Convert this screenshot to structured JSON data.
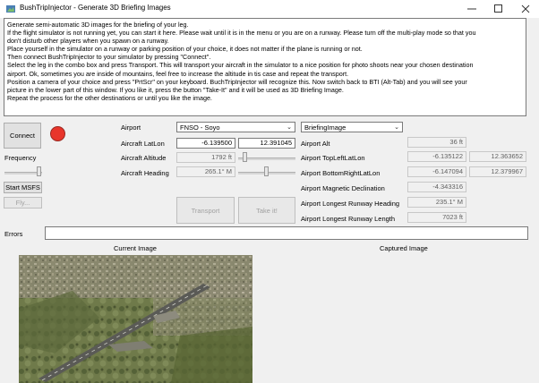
{
  "window": {
    "title": "BushTripInjector - Generate 3D Briefing Images",
    "minimize_icon": "minimize-icon",
    "maximize_icon": "maximize-icon",
    "close_icon": "close-icon"
  },
  "instructions": [
    "Generate semi-automatic 3D images for the briefing of your leg.",
    "If the flight simulator is not running yet, you can start it here. Please wait until it is in the menu or you are on a runway. Please turn off the multi-play mode so that you",
    "don't disturb other players when you spawn on a runway.",
    "Place yourself in the simulator on a runway or parking position of your choice, it does not matter if the plane is running or not.",
    "Then connect BushTripInjector to your simulator by pressing \"Connect\".",
    "Select the leg in the combo box and press Transport. This will transport your aircraft in the simulator to a nice position for photo shoots near your chosen destination",
    "airport. Ok, sometimes you are inside of mountains, feel free to increase the altitude in tis case and repeat the transport.",
    " Position a camera of your choice and press \"PrtScr\" on your keyboard. BuchTripInjector will recognize this. Now switch back to BTI (Alt-Tab) and you will see your",
    "picture in the lower part of this window. If you like it, press the button \"Take-It\" and it will be used as 3D Briefing Image.",
    "Repeat the process for the other destinations or until you like the image."
  ],
  "controls": {
    "connect_label": "Connect",
    "status_color": "#e8352b",
    "frequency_label": "Frequency",
    "start_msfs_label": "Start MSFS",
    "fly_label": "Fly...",
    "transport_label": "Transport",
    "take_it_label": "Take it!",
    "errors_label": "Errors",
    "errors_value": ""
  },
  "aircraft": {
    "airport_label": "Airport",
    "airport_value": "FNSO - Soyo",
    "latlon_label": "Aircraft LatLon",
    "lat_value": "-6.139500",
    "lon_value": "12.391045",
    "altitude_label": "Aircraft Altitude",
    "altitude_value": "1792 ft",
    "heading_label": "Aircraft Heading",
    "heading_value": "265.1° M"
  },
  "airport_info": {
    "image_type_value": "BriefingImage",
    "alt_label": "Airport Alt",
    "alt_value": "36 ft",
    "topleft_label": "Airport TopLeftLatLon",
    "topleft_lat": "-6.135122",
    "topleft_lon": "12.363652",
    "bottomright_label": "Airport BottomRightLatLon",
    "bottomright_lat": "-6.147094",
    "bottomright_lon": "12.379967",
    "magdec_label": "Airport Magnetic Declination",
    "magdec_value": "-4.343316",
    "rwy_heading_label": "Airport Longest Runway Heading",
    "rwy_heading_value": "235.1° M",
    "rwy_length_label": "Airport Longest Runway Length",
    "rwy_length_value": "7023 ft"
  },
  "images": {
    "current_label": "Current Image",
    "captured_label": "Captured Image"
  }
}
